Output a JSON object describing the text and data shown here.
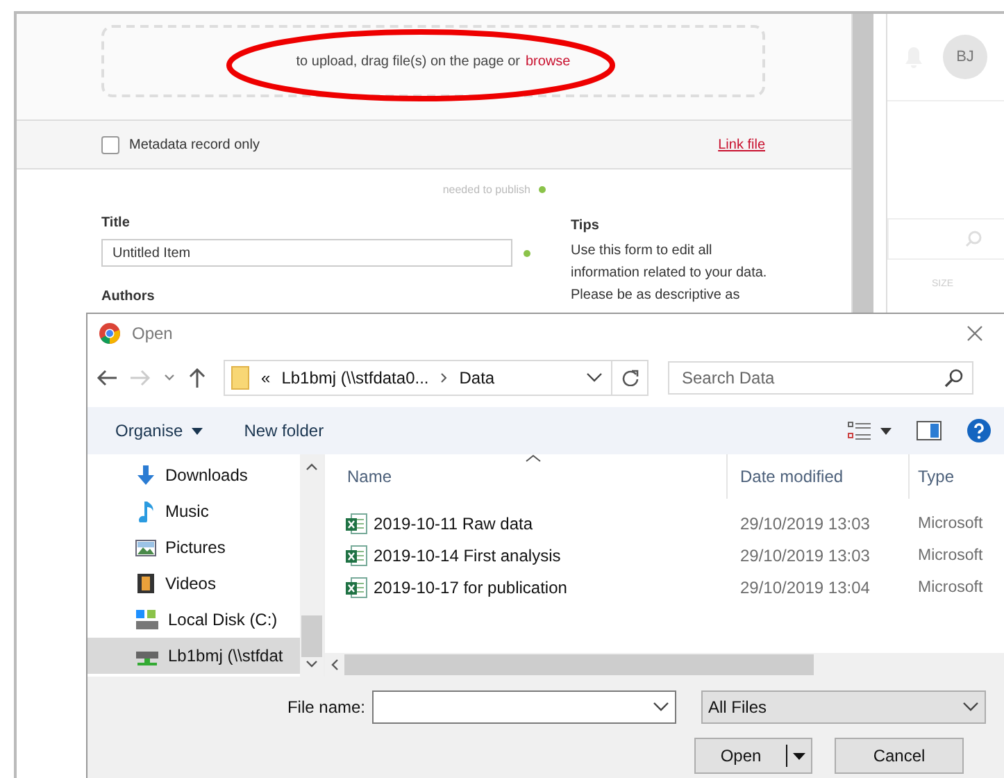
{
  "page": {
    "upload": {
      "text": "to upload, drag file(s) on the page or",
      "link": "browse"
    },
    "metadata_only": {
      "label": "Metadata record only",
      "checked": false
    },
    "link_file": "Link file",
    "needed_to_publish": "needed to publish",
    "title_field": {
      "label": "Title",
      "value": "Untitled Item"
    },
    "authors_label": "Authors",
    "tips": {
      "heading": "Tips",
      "text": "Use this form to edit all information related to your data. Please be as descriptive as"
    },
    "avatar": "BJ",
    "size_label": "SIZE"
  },
  "dialog": {
    "title": "Open",
    "address": {
      "prefix": "«",
      "segments": [
        "Lb1bmj (\\\\stfdata0...",
        "Data"
      ]
    },
    "search": {
      "placeholder": "Search Data"
    },
    "toolbar": {
      "organise": "Organise",
      "new_folder": "New folder"
    },
    "nav_items": [
      {
        "label": "Downloads",
        "kind": "downloads",
        "selected": false
      },
      {
        "label": "Music",
        "kind": "music",
        "selected": false
      },
      {
        "label": "Pictures",
        "kind": "pictures",
        "selected": false
      },
      {
        "label": "Videos",
        "kind": "videos",
        "selected": false
      },
      {
        "label": "Local Disk (C:)",
        "kind": "disk",
        "selected": false
      },
      {
        "label": "Lb1bmj (\\\\stfdat",
        "kind": "network",
        "selected": true
      }
    ],
    "columns": [
      "Name",
      "Date modified",
      "Type"
    ],
    "files": [
      {
        "name": "2019-10-11 Raw data",
        "date": "29/10/2019 13:03",
        "type": "Microsoft",
        "selected": false
      },
      {
        "name": "2019-10-14 First analysis",
        "date": "29/10/2019 13:03",
        "type": "Microsoft",
        "selected": false
      },
      {
        "name": "2019-10-17 for publication",
        "date": "29/10/2019 13:04",
        "type": "Microsoft",
        "selected": false
      }
    ],
    "file_name_label": "File name:",
    "file_type": "All Files",
    "buttons": {
      "open": "Open",
      "cancel": "Cancel"
    }
  }
}
